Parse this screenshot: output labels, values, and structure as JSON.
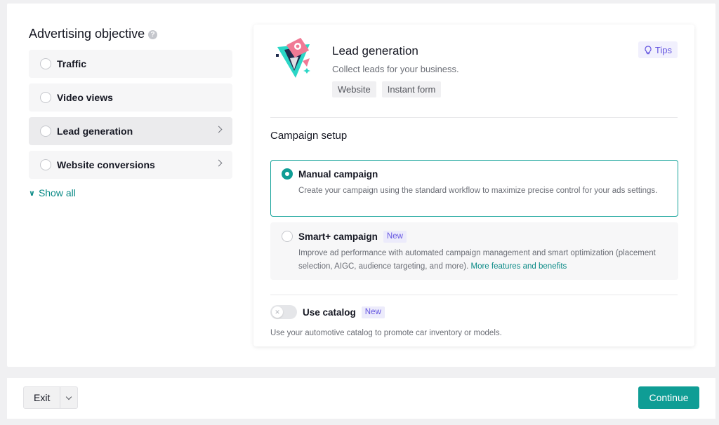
{
  "objective": {
    "title": "Advertising objective",
    "help_icon": "?",
    "items": [
      {
        "label": "Traffic",
        "selected": false,
        "has_chevron": false
      },
      {
        "label": "Video views",
        "selected": false,
        "has_chevron": false
      },
      {
        "label": "Lead generation",
        "selected": true,
        "has_chevron": true
      },
      {
        "label": "Website conversions",
        "selected": false,
        "has_chevron": true
      }
    ],
    "show_all": "Show all"
  },
  "hero": {
    "title": "Lead generation",
    "description": "Collect leads for your business.",
    "tags": [
      "Website",
      "Instant form"
    ],
    "tips_label": "Tips",
    "logo_icon": "funnel-illustration-icon"
  },
  "setup": {
    "title": "Campaign setup",
    "manual": {
      "title": "Manual campaign",
      "description": "Create your campaign using the standard workflow to maximize precise control for your ads settings.",
      "checked": true
    },
    "smart": {
      "title": "Smart+ campaign",
      "badge": "New",
      "description": "Improve ad performance with automated campaign management and smart optimization (placement selection, AIGC, audience targeting, and more).",
      "link": "More features and benefits",
      "checked": false
    }
  },
  "catalog": {
    "label": "Use catalog",
    "badge": "New",
    "description": "Use your automotive catalog to promote car inventory or models.",
    "enabled": false
  },
  "footer": {
    "exit_label": "Exit",
    "continue_label": "Continue"
  },
  "colors": {
    "accent": "#0f9d95",
    "link": "#0a8a86",
    "badge_text": "#6455e0"
  }
}
